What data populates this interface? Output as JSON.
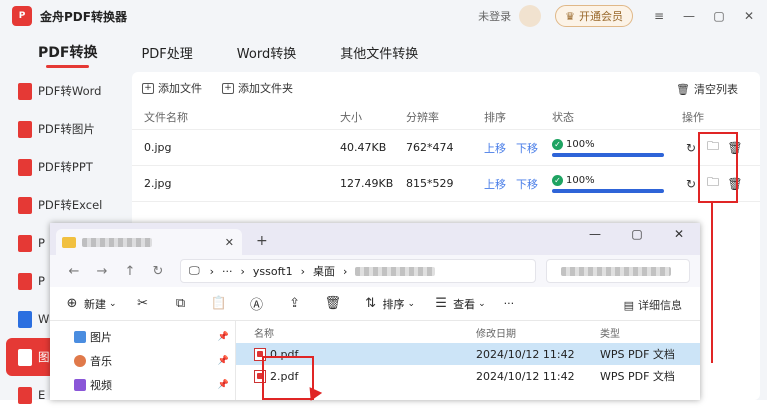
{
  "app": {
    "title": "金舟PDF转换器",
    "login": "未登录",
    "vip": "开通会员"
  },
  "window_controls": {
    "menu": "≡",
    "min": "—",
    "max": "▢",
    "close": "✕"
  },
  "nav": {
    "tabs": [
      {
        "label": "PDF转换"
      },
      {
        "label": "PDF处理"
      },
      {
        "label": "Word转换"
      },
      {
        "label": "其他文件转换"
      }
    ]
  },
  "sidebar": {
    "items": [
      {
        "label": "PDF转Word"
      },
      {
        "label": "PDF转图片"
      },
      {
        "label": "PDF转PPT"
      },
      {
        "label": "PDF转Excel"
      },
      {
        "label": "P"
      },
      {
        "label": "P"
      },
      {
        "label": "W"
      },
      {
        "label": "图"
      },
      {
        "label": "E"
      }
    ]
  },
  "toolbar": {
    "add_file": "添加文件",
    "add_folder": "添加文件夹",
    "clear": "清空列表"
  },
  "table": {
    "headers": {
      "name": "文件名称",
      "size": "大小",
      "resolution": "分辨率",
      "order": "排序",
      "status": "状态",
      "ops": "操作"
    },
    "rows": [
      {
        "name": "0.jpg",
        "size": "40.47KB",
        "resolution": "762*474",
        "up": "上移",
        "down": "下移",
        "progress_text": "100%",
        "progress": 100
      },
      {
        "name": "2.jpg",
        "size": "127.49KB",
        "resolution": "815*529",
        "up": "上移",
        "down": "下移",
        "progress_text": "100%",
        "progress": 100
      }
    ]
  },
  "explorer": {
    "new_tab": "+",
    "tab_close": "✕",
    "window_controls": {
      "min": "—",
      "max": "▢",
      "close": "✕"
    },
    "address": {
      "more": "···",
      "crumbs": [
        "yssoft1",
        "桌面"
      ]
    },
    "commands": {
      "new": "新建",
      "sort": "排序",
      "view": "查看",
      "more": "···",
      "details": "详细信息"
    },
    "quick_access": [
      {
        "label": "图片"
      },
      {
        "label": "音乐"
      },
      {
        "label": "视频"
      }
    ],
    "columns": {
      "name": "名称",
      "modified": "修改日期",
      "type": "类型"
    },
    "files": [
      {
        "name": "0.pdf",
        "modified": "2024/10/12 11:42",
        "type": "WPS PDF 文档"
      },
      {
        "name": "2.pdf",
        "modified": "2024/10/12 11:42",
        "type": "WPS PDF 文档"
      }
    ]
  },
  "colors": {
    "accent": "#e53935",
    "link": "#4a7ee8",
    "progress": "#2e64d8",
    "annotation": "#e02525"
  }
}
